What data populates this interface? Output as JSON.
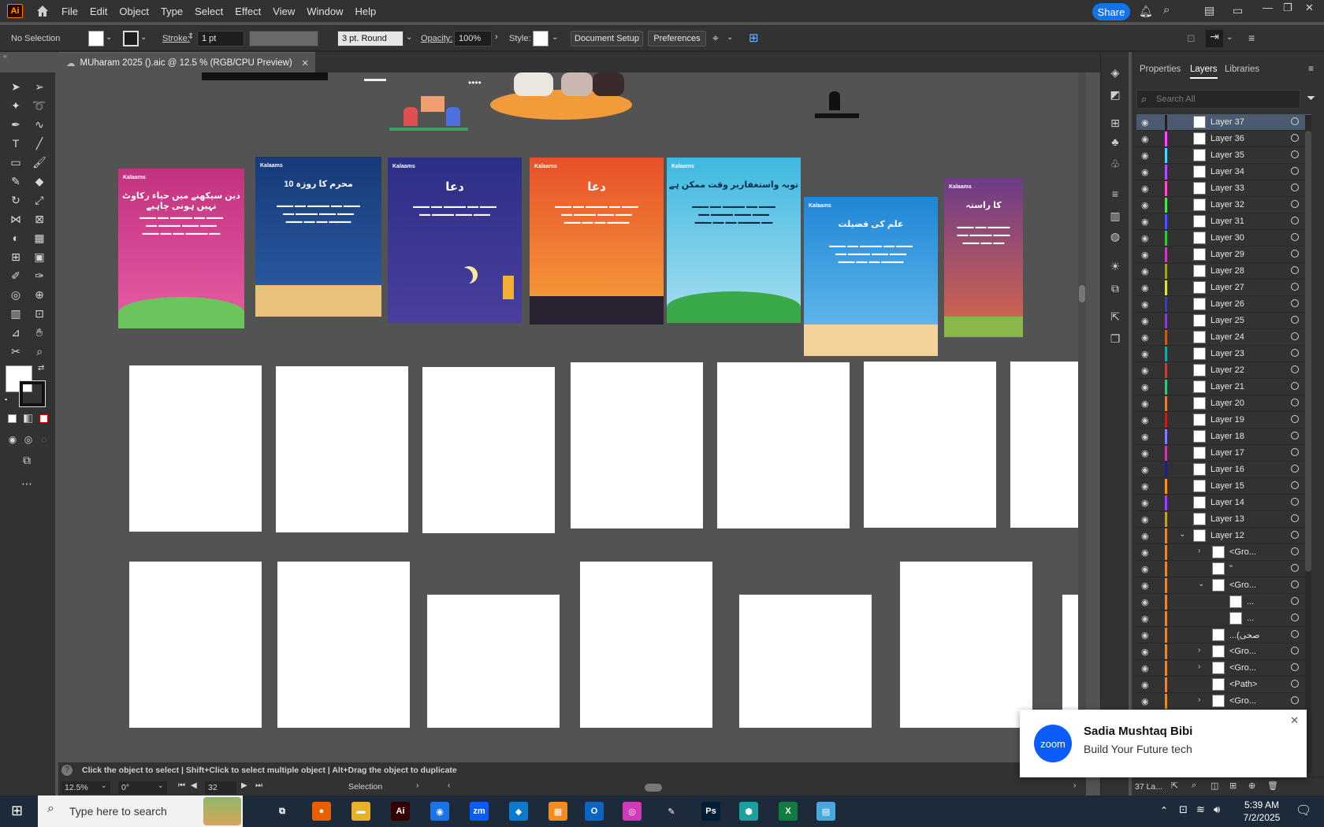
{
  "app": {
    "logo": "Ai",
    "menus": [
      "File",
      "Edit",
      "Object",
      "Type",
      "Select",
      "Effect",
      "View",
      "Window",
      "Help"
    ],
    "share_label": "Share"
  },
  "control_bar": {
    "selection": "No Selection",
    "stroke_label": "Stroke:",
    "stroke_value": "1 pt",
    "brush_value": "3 pt. Round",
    "opacity_label": "Opacity:",
    "opacity_value": "100%",
    "style_label": "Style:",
    "document_setup": "Document Setup",
    "preferences": "Preferences"
  },
  "document": {
    "tab_title": "MUharam 2025 ().aic @ 12.5 % (RGB/CPU Preview)",
    "close": "✕"
  },
  "posters": [
    {
      "brand": "Kalaams",
      "title": "دین سیکھنے میں حیاء رکاوٹ نہیں ہونی چاہیے",
      "color_top": "#c2327f",
      "color_bottom": "#e85da4"
    },
    {
      "brand": "Kalaams",
      "title": "10 محرم کا روزہ",
      "color_top": "#173a78",
      "color_bottom": "#2d5fa8"
    },
    {
      "brand": "Kalaams",
      "title": "دعا",
      "color_top": "#2c2f86",
      "color_bottom": "#4a3f9e"
    },
    {
      "brand": "Kalaams",
      "title": "دعا",
      "color_top": "#e8502a",
      "color_bottom": "#f6a13a"
    },
    {
      "brand": "Kalaams",
      "title": "توبہ واستغفاربر وقت ممکن ہے",
      "color_top": "#3eb8e0",
      "color_bottom": "#a8dff0"
    },
    {
      "brand": "Kalaams",
      "title": "علم کی فضیلت",
      "color_top": "#1f86d6",
      "color_bottom": "#6cc0ef"
    },
    {
      "brand": "Kalaams",
      "title": "کا راستہ",
      "color_top": "#6e3a8a",
      "color_bottom": "#d96a4a"
    }
  ],
  "status": {
    "hint": "Click the object to select  |  Shift+Click to select multiple object  |  Alt+Drag the object to duplicate",
    "zoom": "12.5%",
    "rotation": "0°",
    "artboard": "32",
    "tool": "Selection"
  },
  "panel": {
    "tabs": [
      "Properties",
      "Layers",
      "Libraries"
    ],
    "search_placeholder": "Search All",
    "footer": "37 La..."
  },
  "layers": [
    {
      "name": "Layer 37",
      "color": "#1f1f1f",
      "selected": true
    },
    {
      "name": "Layer 36",
      "color": "#ff4aff"
    },
    {
      "name": "Layer 35",
      "color": "#4fd6ff"
    },
    {
      "name": "Layer 34",
      "color": "#b050ff"
    },
    {
      "name": "Layer 33",
      "color": "#ff50c8"
    },
    {
      "name": "Layer 32",
      "color": "#50e050"
    },
    {
      "name": "Layer 31",
      "color": "#5050ff"
    },
    {
      "name": "Layer 30",
      "color": "#40c040"
    },
    {
      "name": "Layer 29",
      "color": "#c040c0"
    },
    {
      "name": "Layer 28",
      "color": "#a0a020"
    },
    {
      "name": "Layer 27",
      "color": "#e0e050"
    },
    {
      "name": "Layer 26",
      "color": "#4040a0"
    },
    {
      "name": "Layer 25",
      "color": "#8040c0"
    },
    {
      "name": "Layer 24",
      "color": "#c06020"
    },
    {
      "name": "Layer 23",
      "color": "#20a0a0"
    },
    {
      "name": "Layer 22",
      "color": "#c04040"
    },
    {
      "name": "Layer 21",
      "color": "#40c080"
    },
    {
      "name": "Layer 20",
      "color": "#e08040"
    },
    {
      "name": "Layer 19",
      "color": "#c02020"
    },
    {
      "name": "Layer 18",
      "color": "#8080ff"
    },
    {
      "name": "Layer 17",
      "color": "#c040a0"
    },
    {
      "name": "Layer 16",
      "color": "#202080"
    },
    {
      "name": "Layer 15",
      "color": "#ff9020"
    },
    {
      "name": "Layer 14",
      "color": "#a040ff"
    },
    {
      "name": "Layer 13",
      "color": "#c0a030"
    },
    {
      "name": "Layer 12",
      "color": "#e08a3a",
      "expanded": true
    }
  ],
  "sublayers": [
    {
      "name": "<Gro...",
      "indent": 1,
      "arrow": "›"
    },
    {
      "name": "\"",
      "indent": 1,
      "arrow": ""
    },
    {
      "name": "<Gro...",
      "indent": 1,
      "arrow": "⌄"
    },
    {
      "name": "...",
      "indent": 2,
      "arrow": ""
    },
    {
      "name": "...",
      "indent": 2,
      "arrow": ""
    },
    {
      "name": "...(صحی",
      "indent": 1,
      "arrow": ""
    },
    {
      "name": "<Gro...",
      "indent": 1,
      "arrow": "›"
    },
    {
      "name": "<Gro...",
      "indent": 1,
      "arrow": "›"
    },
    {
      "name": "<Path>",
      "indent": 1,
      "arrow": ""
    },
    {
      "name": "<Gro...",
      "indent": 1,
      "arrow": "›"
    }
  ],
  "notification": {
    "app": "zoom",
    "title": "Sadia Mushtaq Bibi",
    "message": "Build Your Future  tech",
    "close": "✕"
  },
  "taskbar": {
    "search_placeholder": "Type here to search",
    "time": "5:39 AM",
    "date": "7/2/2025",
    "apps": [
      {
        "label": "⧉",
        "color": "#1c2a3a"
      },
      {
        "label": "●",
        "color": "#e66000"
      },
      {
        "label": "▬",
        "color": "#e8b12a"
      },
      {
        "label": "Ai",
        "color": "#330000"
      },
      {
        "label": "◉",
        "color": "#1a73e8"
      },
      {
        "label": "zm",
        "color": "#0b5cff"
      },
      {
        "label": "◆",
        "color": "#0a7acc"
      },
      {
        "label": "▦",
        "color": "#f28b20"
      },
      {
        "label": "O",
        "color": "#0a64c2"
      },
      {
        "label": "◎",
        "color": "#d03ab8"
      },
      {
        "label": "✎",
        "color": "#1c2a3a"
      },
      {
        "label": "Ps",
        "color": "#001e36"
      },
      {
        "label": "⬢",
        "color": "#1f9e9e"
      },
      {
        "label": "X",
        "color": "#107c41"
      },
      {
        "label": "▤",
        "color": "#4aa8e0"
      }
    ]
  }
}
